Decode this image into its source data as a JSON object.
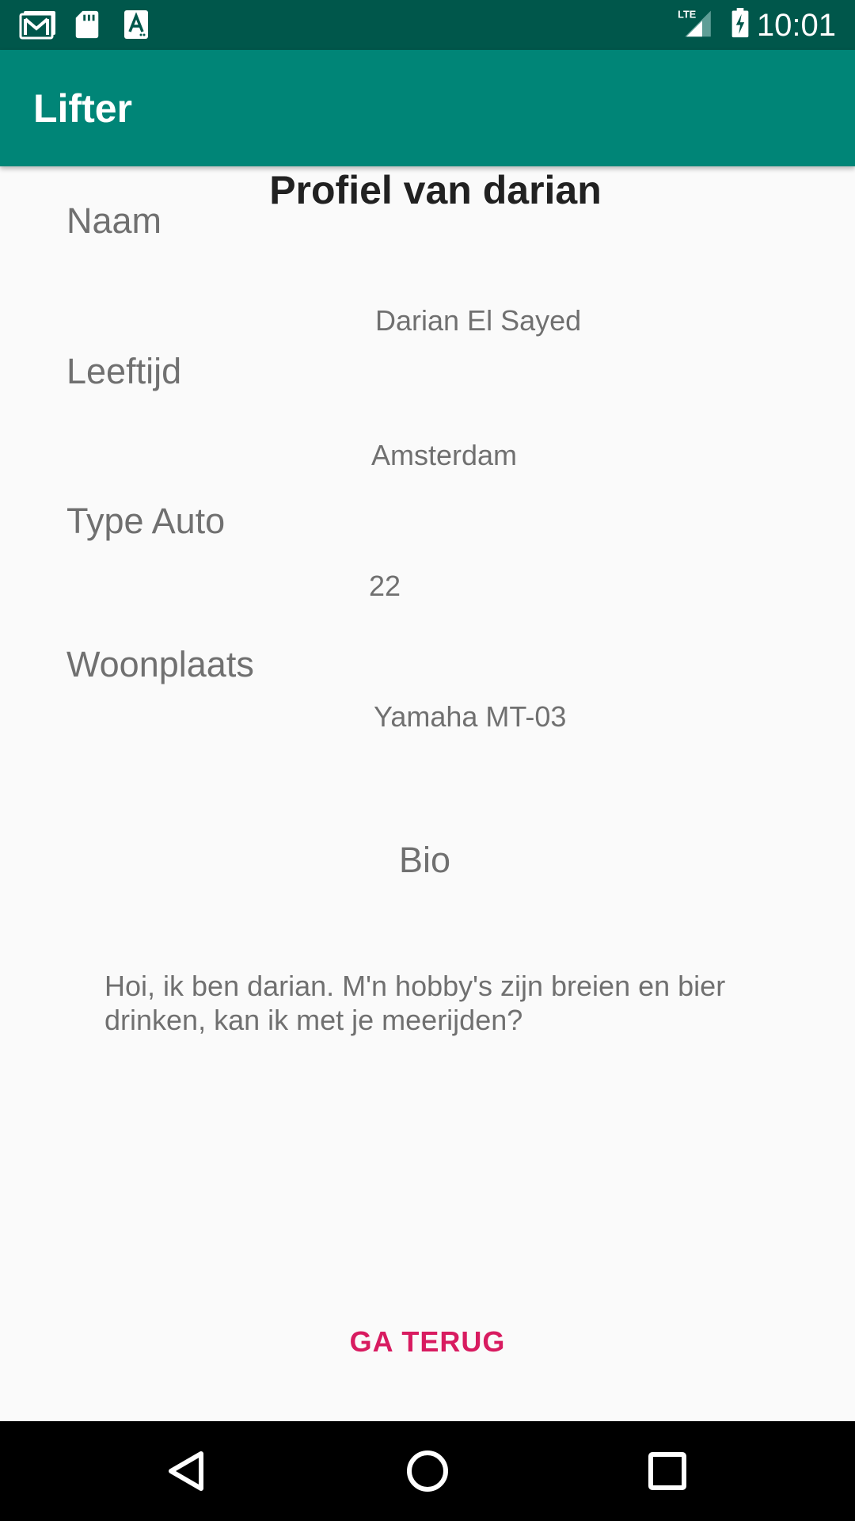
{
  "status_bar": {
    "time": "10:01",
    "network": "LTE",
    "notification_icons": [
      "gmail-icon",
      "sd-card-icon",
      "font-app-icon"
    ],
    "system_icons": [
      "lte-signal-icon",
      "battery-charging-icon"
    ]
  },
  "app_bar": {
    "title": "Lifter"
  },
  "profile": {
    "heading": "Profiel van darian",
    "labels": {
      "name": "Naam",
      "age": "Leeftijd",
      "car_type": "Type Auto",
      "residence": "Woonplaats"
    },
    "values": {
      "name": "Darian El Sayed",
      "residence": "Amsterdam",
      "age": "22",
      "car_type": "Yamaha MT-03"
    },
    "bio_title": "Bio",
    "bio_text": "Hoi, ik ben darian. M'n hobby's zijn breien en bier drinken, kan ik met je meerijden?"
  },
  "actions": {
    "back_label": "GA TERUG"
  },
  "nav_bar": {
    "buttons": [
      "back-icon",
      "home-icon",
      "recents-icon"
    ]
  },
  "colors": {
    "status_bar": "#00574b",
    "primary": "#008577",
    "accent": "#d81b60",
    "background": "#fafafa"
  }
}
